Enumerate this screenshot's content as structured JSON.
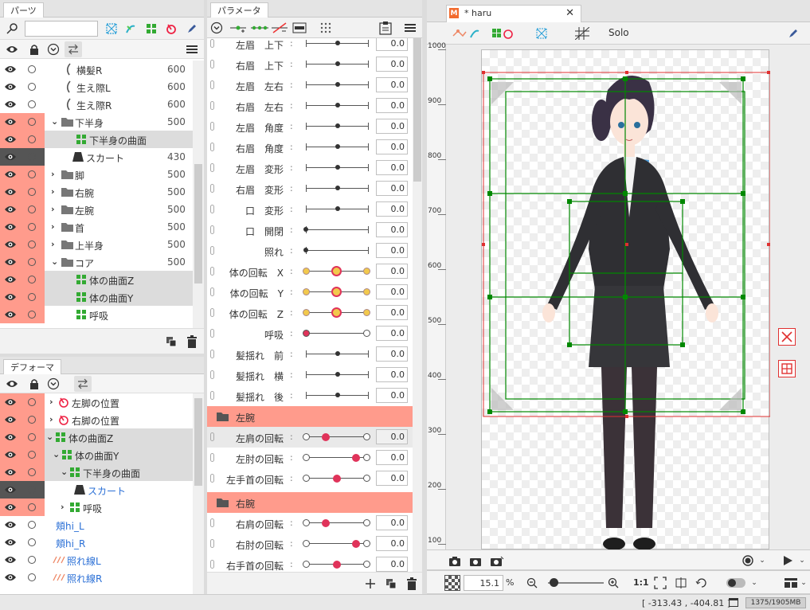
{
  "parts": {
    "tab": "パーツ",
    "rows": [
      {
        "name": "横髪R",
        "num": "600"
      },
      {
        "name": "生え際L",
        "num": "600"
      },
      {
        "name": "生え際R",
        "num": "600"
      },
      {
        "name": "下半身",
        "num": "500"
      },
      {
        "name": "下半身の曲面",
        "num": ""
      },
      {
        "name": "スカート",
        "num": "430"
      },
      {
        "name": "脚",
        "num": "500"
      },
      {
        "name": "右腕",
        "num": "500"
      },
      {
        "name": "左腕",
        "num": "500"
      },
      {
        "name": "首",
        "num": "500"
      },
      {
        "name": "上半身",
        "num": "500"
      },
      {
        "name": "コア",
        "num": "500"
      },
      {
        "name": "体の曲面Z",
        "num": ""
      },
      {
        "name": "体の曲面Y",
        "num": ""
      },
      {
        "name": "呼吸",
        "num": ""
      }
    ]
  },
  "deformer": {
    "tab": "デフォーマ",
    "rows": [
      {
        "name": "左脚の位置"
      },
      {
        "name": "右脚の位置"
      },
      {
        "name": "体の曲面Z"
      },
      {
        "name": "体の曲面Y"
      },
      {
        "name": "下半身の曲面"
      },
      {
        "name": "スカート"
      },
      {
        "name": "呼吸"
      },
      {
        "name": "頬hi_L"
      },
      {
        "name": "頬hi_R"
      },
      {
        "name": "照れ線L"
      },
      {
        "name": "照れ線R"
      }
    ]
  },
  "params": {
    "tab": "パラメータ",
    "rows": [
      {
        "label": "左眉　上下",
        "value": "0.0"
      },
      {
        "label": "右眉　上下",
        "value": "0.0"
      },
      {
        "label": "左眉　左右",
        "value": "0.0"
      },
      {
        "label": "右眉　左右",
        "value": "0.0"
      },
      {
        "label": "左眉　角度",
        "value": "0.0"
      },
      {
        "label": "右眉　角度",
        "value": "0.0"
      },
      {
        "label": "左眉　変形",
        "value": "0.0"
      },
      {
        "label": "右眉　変形",
        "value": "0.0"
      },
      {
        "label": "口　変形",
        "value": "0.0"
      },
      {
        "label": "口　開閉",
        "value": "0.0"
      },
      {
        "label": "照れ",
        "value": "0.0"
      },
      {
        "label": "体の回転　X",
        "value": "0.0"
      },
      {
        "label": "体の回転　Y",
        "value": "0.0"
      },
      {
        "label": "体の回転　Z",
        "value": "0.0"
      },
      {
        "label": "呼吸",
        "value": "0.0"
      },
      {
        "label": "髪揺れ　前",
        "value": "0.0"
      },
      {
        "label": "髪揺れ　横",
        "value": "0.0"
      },
      {
        "label": "髪揺れ　後",
        "value": "0.0"
      }
    ],
    "group_left": "左腕",
    "left_rows": [
      {
        "label": "左肩の回転",
        "value": "0.0"
      },
      {
        "label": "左肘の回転",
        "value": "0.0"
      },
      {
        "label": "左手首の回転",
        "value": "0.0"
      }
    ],
    "group_right": "右腕",
    "right_rows": [
      {
        "label": "右肩の回転",
        "value": "0.0"
      },
      {
        "label": "右肘の回転",
        "value": "0.0"
      },
      {
        "label": "右手首の回転",
        "value": "0.0"
      }
    ]
  },
  "view": {
    "tab": "* haru",
    "solo": "Solo",
    "ruler": [
      "1000",
      "900",
      "800",
      "700",
      "600",
      "500",
      "400",
      "300",
      "200",
      "100",
      "0"
    ],
    "zoom": "15.1",
    "zoom_unit": "%",
    "ratio": "1:1"
  },
  "status": {
    "coords": "[ -313.43 , -404.81 ]",
    "memory": "1375/1905MB"
  },
  "colors": {
    "accent": "#ff9b8c",
    "grid": "#008800",
    "selection": "#e03030"
  }
}
